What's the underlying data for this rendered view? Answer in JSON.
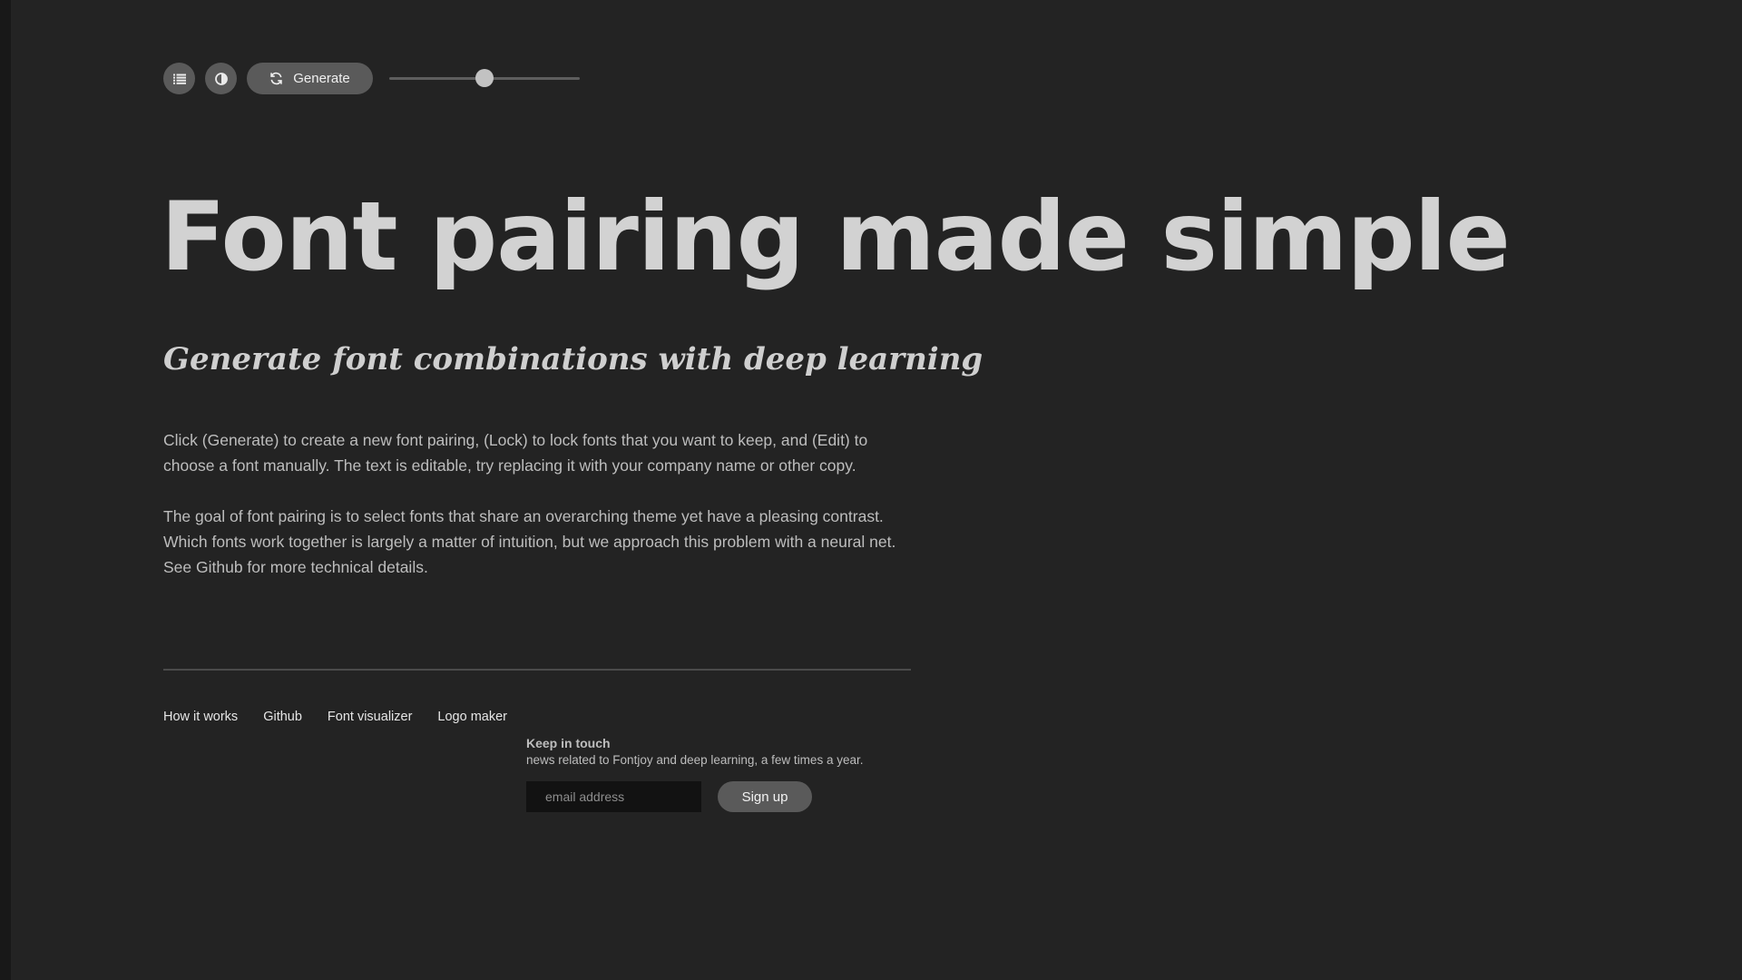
{
  "toolbar": {
    "list_icon": "list-icon",
    "contrast_icon": "contrast-icon",
    "generate_icon": "refresh-icon",
    "generate_label": "Generate",
    "slider_value": 0.5
  },
  "hero": {
    "title": "Font pairing made simple",
    "subtitle": "Generate font combinations with deep learning"
  },
  "body": {
    "paragraph1": "Click (Generate) to create a new font pairing, (Lock) to lock fonts that you want to keep, and (Edit) to choose a font manually. The text is editable, try replacing it with your company name or other copy.",
    "paragraph2": "The goal of font pairing is to select fonts that share an overarching theme yet have a pleasing contrast. Which fonts work together is largely a matter of intuition, but we approach this problem with a neural net. See Github for more technical details."
  },
  "footer": {
    "links": [
      "How it works",
      "Github",
      "Font visualizer",
      "Logo maker"
    ],
    "newsletter": {
      "title": "Keep in touch",
      "description": "news related to Fontjoy and deep learning, a few times a year.",
      "email_placeholder": "email address",
      "signup_label": "Sign up"
    }
  },
  "colors": {
    "background": "#232323",
    "button": "#5a5a5a",
    "text": "#d2d2d2"
  }
}
